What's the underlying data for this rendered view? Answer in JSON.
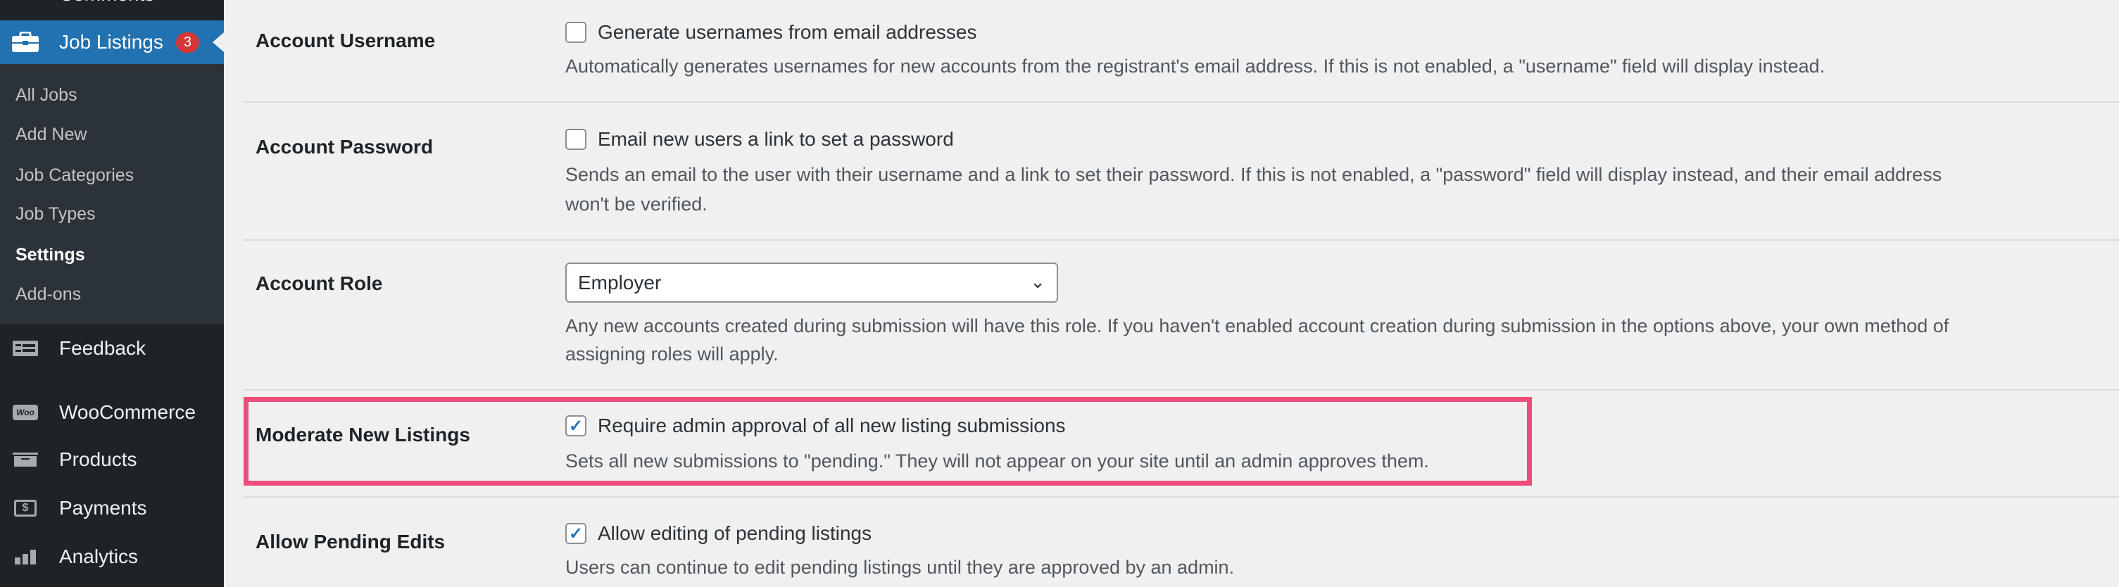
{
  "sidebar": {
    "comments_label": "Comments",
    "job_listings": {
      "label": "Job Listings",
      "badge": "3",
      "icon": "briefcase-icon"
    },
    "submenu": [
      "All Jobs",
      "Add New",
      "Job Categories",
      "Job Types",
      "Settings",
      "Add-ons"
    ],
    "current_submenu": "Settings",
    "items": [
      {
        "label": "Feedback",
        "icon": "feedback-icon"
      },
      {
        "label": "WooCommerce",
        "icon": "woo-icon",
        "icon_text": "Woo"
      },
      {
        "label": "Products",
        "icon": "archive-icon"
      },
      {
        "label": "Payments",
        "icon": "dollar-icon",
        "icon_text": "$"
      },
      {
        "label": "Analytics",
        "icon": "bar-chart-icon"
      }
    ]
  },
  "settings": [
    {
      "label": "Account Username",
      "checkbox": "Generate usernames from email addresses",
      "checked": false,
      "desc": [
        "Automatically generates usernames for new accounts from the registrant's email address. If this is not enabled, a \"username\" field will display instead."
      ]
    },
    {
      "label": "Account Password",
      "checkbox": "Email new users a link to set a password",
      "checked": false,
      "desc": [
        "Sends an email to the user with their username and a link to set their password. If this is not enabled, a \"password\" field will display instead, and their email address",
        "won't be verified."
      ]
    },
    {
      "label": "Account Role",
      "select": "Employer",
      "desc": [
        "Any new accounts created during submission will have this role. If you haven't enabled account creation during submission in the options above, your own method of",
        "assigning roles will apply."
      ]
    },
    {
      "label": "Moderate New Listings",
      "checkbox": "Require admin approval of all new listing submissions",
      "checked": true,
      "desc": [
        "Sets all new submissions to \"pending.\" They will not appear on your site until an admin approves them."
      ]
    },
    {
      "label": "Allow Pending Edits",
      "checkbox": "Allow editing of pending listings",
      "checked": true,
      "desc": [
        "Users can continue to edit pending listings until they are approved by an admin."
      ]
    }
  ],
  "highlight_color": "#ee4d7a",
  "accent": "#2271b1"
}
